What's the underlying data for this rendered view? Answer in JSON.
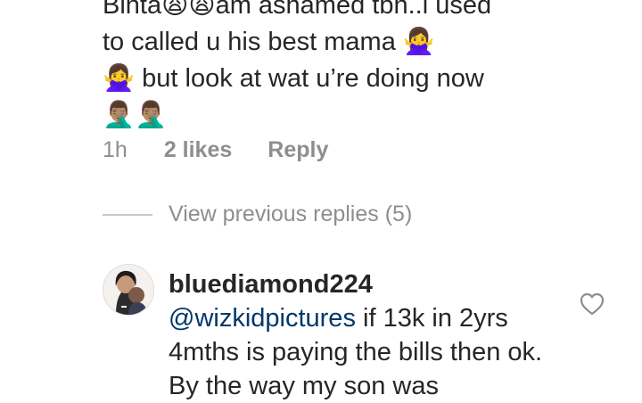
{
  "comment": {
    "line1": "Binta😩😩am ashamed tbh..i used",
    "line2": "to called u his best mama 🙅‍♀️",
    "line3": "🙅‍♀️ but look at wat u’re doing now",
    "line4": "🤦🏽‍♂️🤦🏽‍♂️",
    "time": "1h",
    "likes": "2 likes",
    "reply_label": "Reply"
  },
  "view_previous": {
    "label": "View previous replies (5)"
  },
  "reply": {
    "username": "bluediamond224",
    "mention": "@wizkidpictures",
    "text_after_mention": " if 13k in 2yrs 4mths is paying the bills then ok. By the way my son was",
    "like_icon": "heart-icon"
  },
  "colors": {
    "text": "#262626",
    "secondary": "#8e8e8e",
    "mention": "#00376b",
    "divider": "#c7c7c7"
  }
}
